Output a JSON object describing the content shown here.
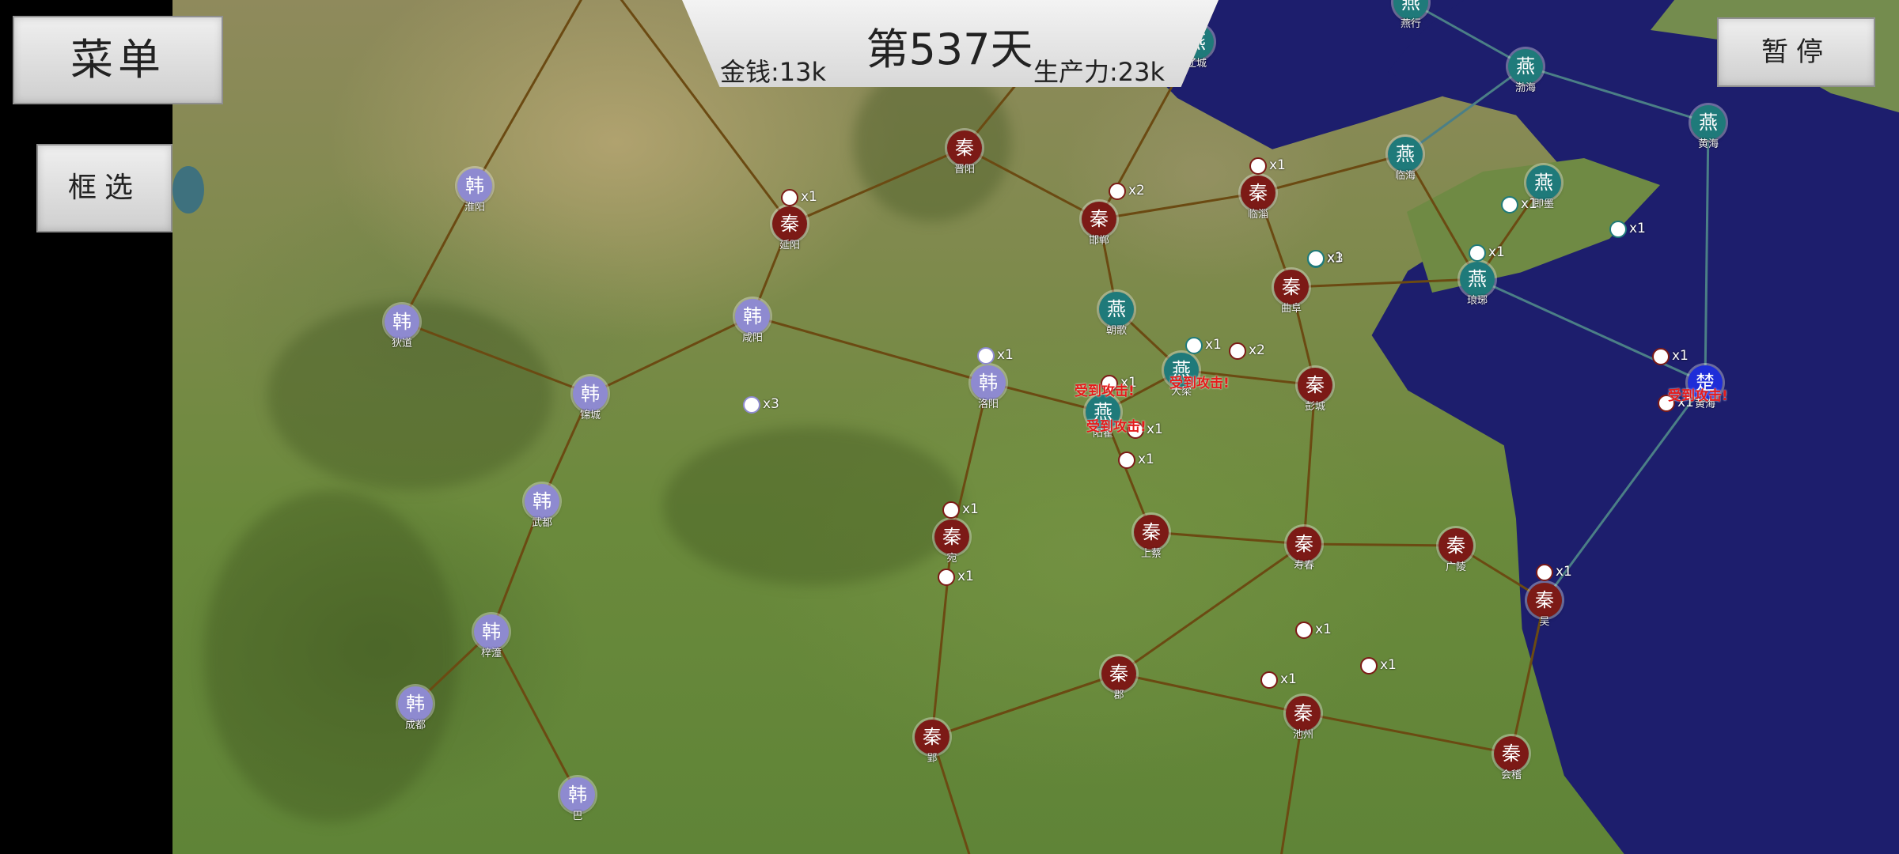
{
  "hud": {
    "day": "第537天",
    "money": "金钱:13k",
    "production": "生产力:23k"
  },
  "buttons": {
    "menu": "菜单",
    "select": "框选",
    "pause": "暂停"
  },
  "factions": {
    "qin": {
      "glyph": "秦",
      "color": "#7c1a16"
    },
    "han": {
      "glyph": "韩",
      "color": "#8e8ad0"
    },
    "yan": {
      "glyph": "燕",
      "color": "#1f7a7a"
    },
    "chu": {
      "glyph": "楚",
      "color": "#1e2dd8"
    }
  },
  "cities": [
    {
      "name": "淮阳",
      "faction": "han"
    },
    {
      "name": "狄道",
      "faction": "han"
    },
    {
      "name": "锦城",
      "faction": "han"
    },
    {
      "name": "咸阳",
      "faction": "han"
    },
    {
      "name": "武都",
      "faction": "han"
    },
    {
      "name": "梓潼",
      "faction": "han"
    },
    {
      "name": "成都",
      "faction": "han"
    },
    {
      "name": "巴",
      "faction": "han"
    },
    {
      "name": "洛阳",
      "faction": "han"
    },
    {
      "name": "晋阳",
      "faction": "qin"
    },
    {
      "name": "延阳",
      "faction": "qin"
    },
    {
      "name": "邯郸",
      "faction": "qin"
    },
    {
      "name": "临淄",
      "faction": "qin"
    },
    {
      "name": "曲阜",
      "faction": "qin"
    },
    {
      "name": "彭城",
      "faction": "qin"
    },
    {
      "name": "宛",
      "faction": "qin"
    },
    {
      "name": "上蔡",
      "faction": "qin"
    },
    {
      "name": "寿春",
      "faction": "qin"
    },
    {
      "name": "广陵",
      "faction": "qin"
    },
    {
      "name": "吴",
      "faction": "qin"
    },
    {
      "name": "郢",
      "faction": "qin"
    },
    {
      "name": "郡",
      "faction": "qin"
    },
    {
      "name": "池州",
      "faction": "qin"
    },
    {
      "name": "会稽",
      "faction": "qin"
    },
    {
      "name": "朝歌",
      "faction": "yan"
    },
    {
      "name": "大梁",
      "faction": "yan"
    },
    {
      "name": "阳翟",
      "faction": "yan"
    },
    {
      "name": "琅琊",
      "faction": "yan"
    },
    {
      "name": "即墨",
      "faction": "yan"
    },
    {
      "name": "辽城",
      "faction": "yan"
    },
    {
      "name": "渤海",
      "faction": "yan"
    },
    {
      "name": "黄海",
      "faction": "yan"
    },
    {
      "name": "临海",
      "faction": "yan"
    },
    {
      "name": "燕行",
      "faction": "yan"
    },
    {
      "name": "黄海",
      "faction": "chu"
    }
  ],
  "markers": [
    {
      "count": "x1"
    },
    {
      "count": "x3"
    },
    {
      "count": "x1"
    },
    {
      "count": "x2"
    },
    {
      "count": "x1"
    },
    {
      "count": "x1"
    },
    {
      "count": "x3"
    },
    {
      "count": "x1"
    },
    {
      "count": "x1"
    },
    {
      "count": "x2"
    },
    {
      "count": "x1"
    },
    {
      "count": "x1"
    },
    {
      "count": "x1"
    },
    {
      "count": "x1"
    },
    {
      "count": "x1"
    },
    {
      "count": "x1"
    },
    {
      "count": "x1"
    },
    {
      "count": "x1"
    },
    {
      "count": "x1"
    },
    {
      "count": "x1"
    },
    {
      "count": "x1"
    },
    {
      "count": "x1"
    },
    {
      "count": "x1"
    },
    {
      "count": "x1"
    }
  ],
  "alerts": [
    "受到攻击!",
    "受到攻击!",
    "受到攻击!",
    "受到攻击!"
  ]
}
